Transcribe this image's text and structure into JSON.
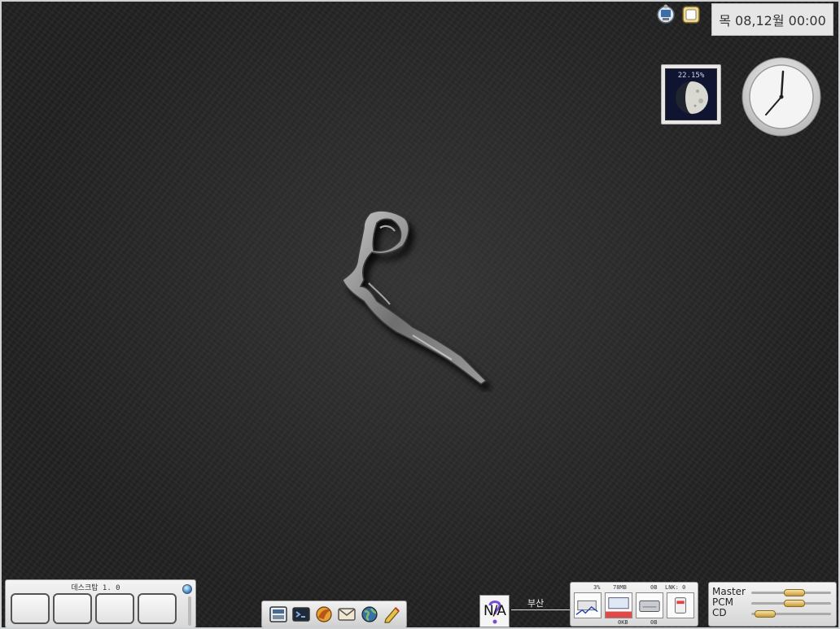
{
  "top_bar": {
    "clock_text": "목 08,12월 00:00",
    "icons": [
      "network-icon",
      "terminal-icon"
    ]
  },
  "moon": {
    "illumination": "22.15%"
  },
  "pager": {
    "label": "데스크탑 1. 0",
    "desktops": 4
  },
  "launcher": {
    "icons": [
      "file-manager-icon",
      "terminal-app-icon",
      "fox-browser-icon",
      "mail-icon",
      "globe-icon",
      "editor-icon"
    ]
  },
  "weather": {
    "status": "N/A",
    "city": "부산"
  },
  "drive_monitor": {
    "cpu": "3%",
    "mem": "78MB",
    "disk_read": "0B",
    "net_label": "LNK: 0",
    "swap": "0KB",
    "disk_write": "0B"
  },
  "mixer": {
    "channels": [
      {
        "name": "Master",
        "level": 0.6
      },
      {
        "name": "PCM",
        "level": 0.6
      },
      {
        "name": "CD",
        "level": 0.15
      }
    ]
  },
  "colors": {
    "background": "#222222",
    "accent": "#3a8fd6",
    "knob": "#c99a3a"
  }
}
